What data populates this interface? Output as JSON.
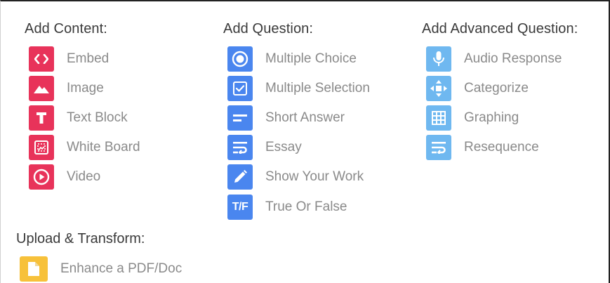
{
  "content": {
    "heading": "Add Content:",
    "items": [
      {
        "label": "Embed",
        "icon": "code-icon"
      },
      {
        "label": "Image",
        "icon": "mountain-image-icon"
      },
      {
        "label": "Text Block",
        "icon": "text-t-icon"
      },
      {
        "label": "White Board",
        "icon": "whiteboard-icon"
      },
      {
        "label": "Video",
        "icon": "play-circle-icon"
      }
    ]
  },
  "question": {
    "heading": "Add Question:",
    "items": [
      {
        "label": "Multiple Choice",
        "icon": "radio-circle-icon"
      },
      {
        "label": "Multiple Selection",
        "icon": "checkbox-icon"
      },
      {
        "label": "Short Answer",
        "icon": "short-lines-icon"
      },
      {
        "label": "Essay",
        "icon": "text-wrap-icon"
      },
      {
        "label": "Show Your Work",
        "icon": "pencil-icon"
      },
      {
        "label": "True Or False",
        "icon": "true-false-icon",
        "icon_text": "T/F"
      }
    ]
  },
  "advanced": {
    "heading": "Add Advanced Question:",
    "items": [
      {
        "label": "Audio Response",
        "icon": "microphone-icon"
      },
      {
        "label": "Categorize",
        "icon": "move-arrows-icon"
      },
      {
        "label": "Graphing",
        "icon": "grid-icon"
      },
      {
        "label": "Resequence",
        "icon": "resequence-icon"
      }
    ]
  },
  "upload": {
    "heading": "Upload & Transform:",
    "items": [
      {
        "label": "Enhance a PDF/Doc",
        "icon": "document-icon"
      }
    ]
  },
  "colors": {
    "content_accent": "#e8335a",
    "question_accent": "#4a86ef",
    "advanced_accent": "#6fb8f0",
    "upload_accent": "#f7c13a",
    "label_text": "#8a8a8a",
    "heading_text": "#3a3a3a"
  }
}
